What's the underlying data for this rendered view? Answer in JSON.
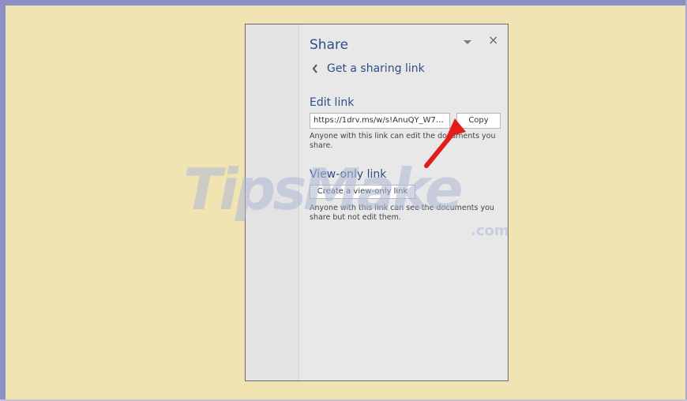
{
  "page": {
    "background_color": "#f1e4b3",
    "frame_color": "#8b8fc6"
  },
  "share_pane": {
    "title": "Share",
    "dropdown_icon": "chevron-down-icon",
    "close_label": "×",
    "back_link": {
      "icon": "chevron-left-icon",
      "label": "Get a sharing link"
    },
    "edit_link": {
      "title": "Edit link",
      "url_value": "https://1drv.ms/w/s!AnuQY_W7gf4Mh0...",
      "copy_label": "Copy",
      "helper": "Anyone with this link can edit the documents you share."
    },
    "view_only_link": {
      "title": "View-only link",
      "button_label": "Create a view-only link",
      "helper": "Anyone with this link can see the documents you share but not edit them."
    }
  },
  "watermark": {
    "main": "TipsMake",
    "suffix": ".com"
  },
  "annotation": {
    "arrow_color": "#e21b1b",
    "icon": "red-arrow-icon"
  }
}
